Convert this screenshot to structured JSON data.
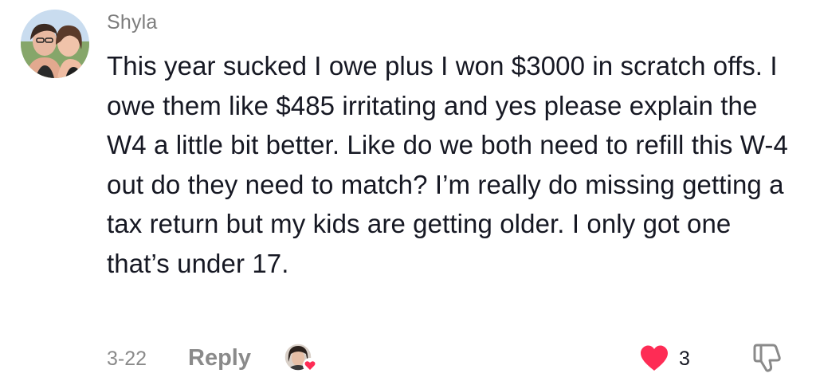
{
  "comment": {
    "username": "Shyla",
    "text": "This year sucked I owe plus I won $3000 in scratch offs. I owe them like $485 irritating and yes please explain the W4 a little bit better. Like do we both need to refill this W-4 out do they need to match? I’m really do missing getting a tax return but my kids are getting older. I only got one that’s under 17.",
    "date": "3-22",
    "reply_label": "Reply",
    "like_count": "3",
    "liked": true
  },
  "icons": {
    "like": "heart-icon",
    "dislike": "thumbs-down-icon",
    "liker": "creator-liked-avatar"
  },
  "colors": {
    "text": "#161823",
    "muted": "#8a8a8a",
    "like_red": "#fe2c55"
  }
}
